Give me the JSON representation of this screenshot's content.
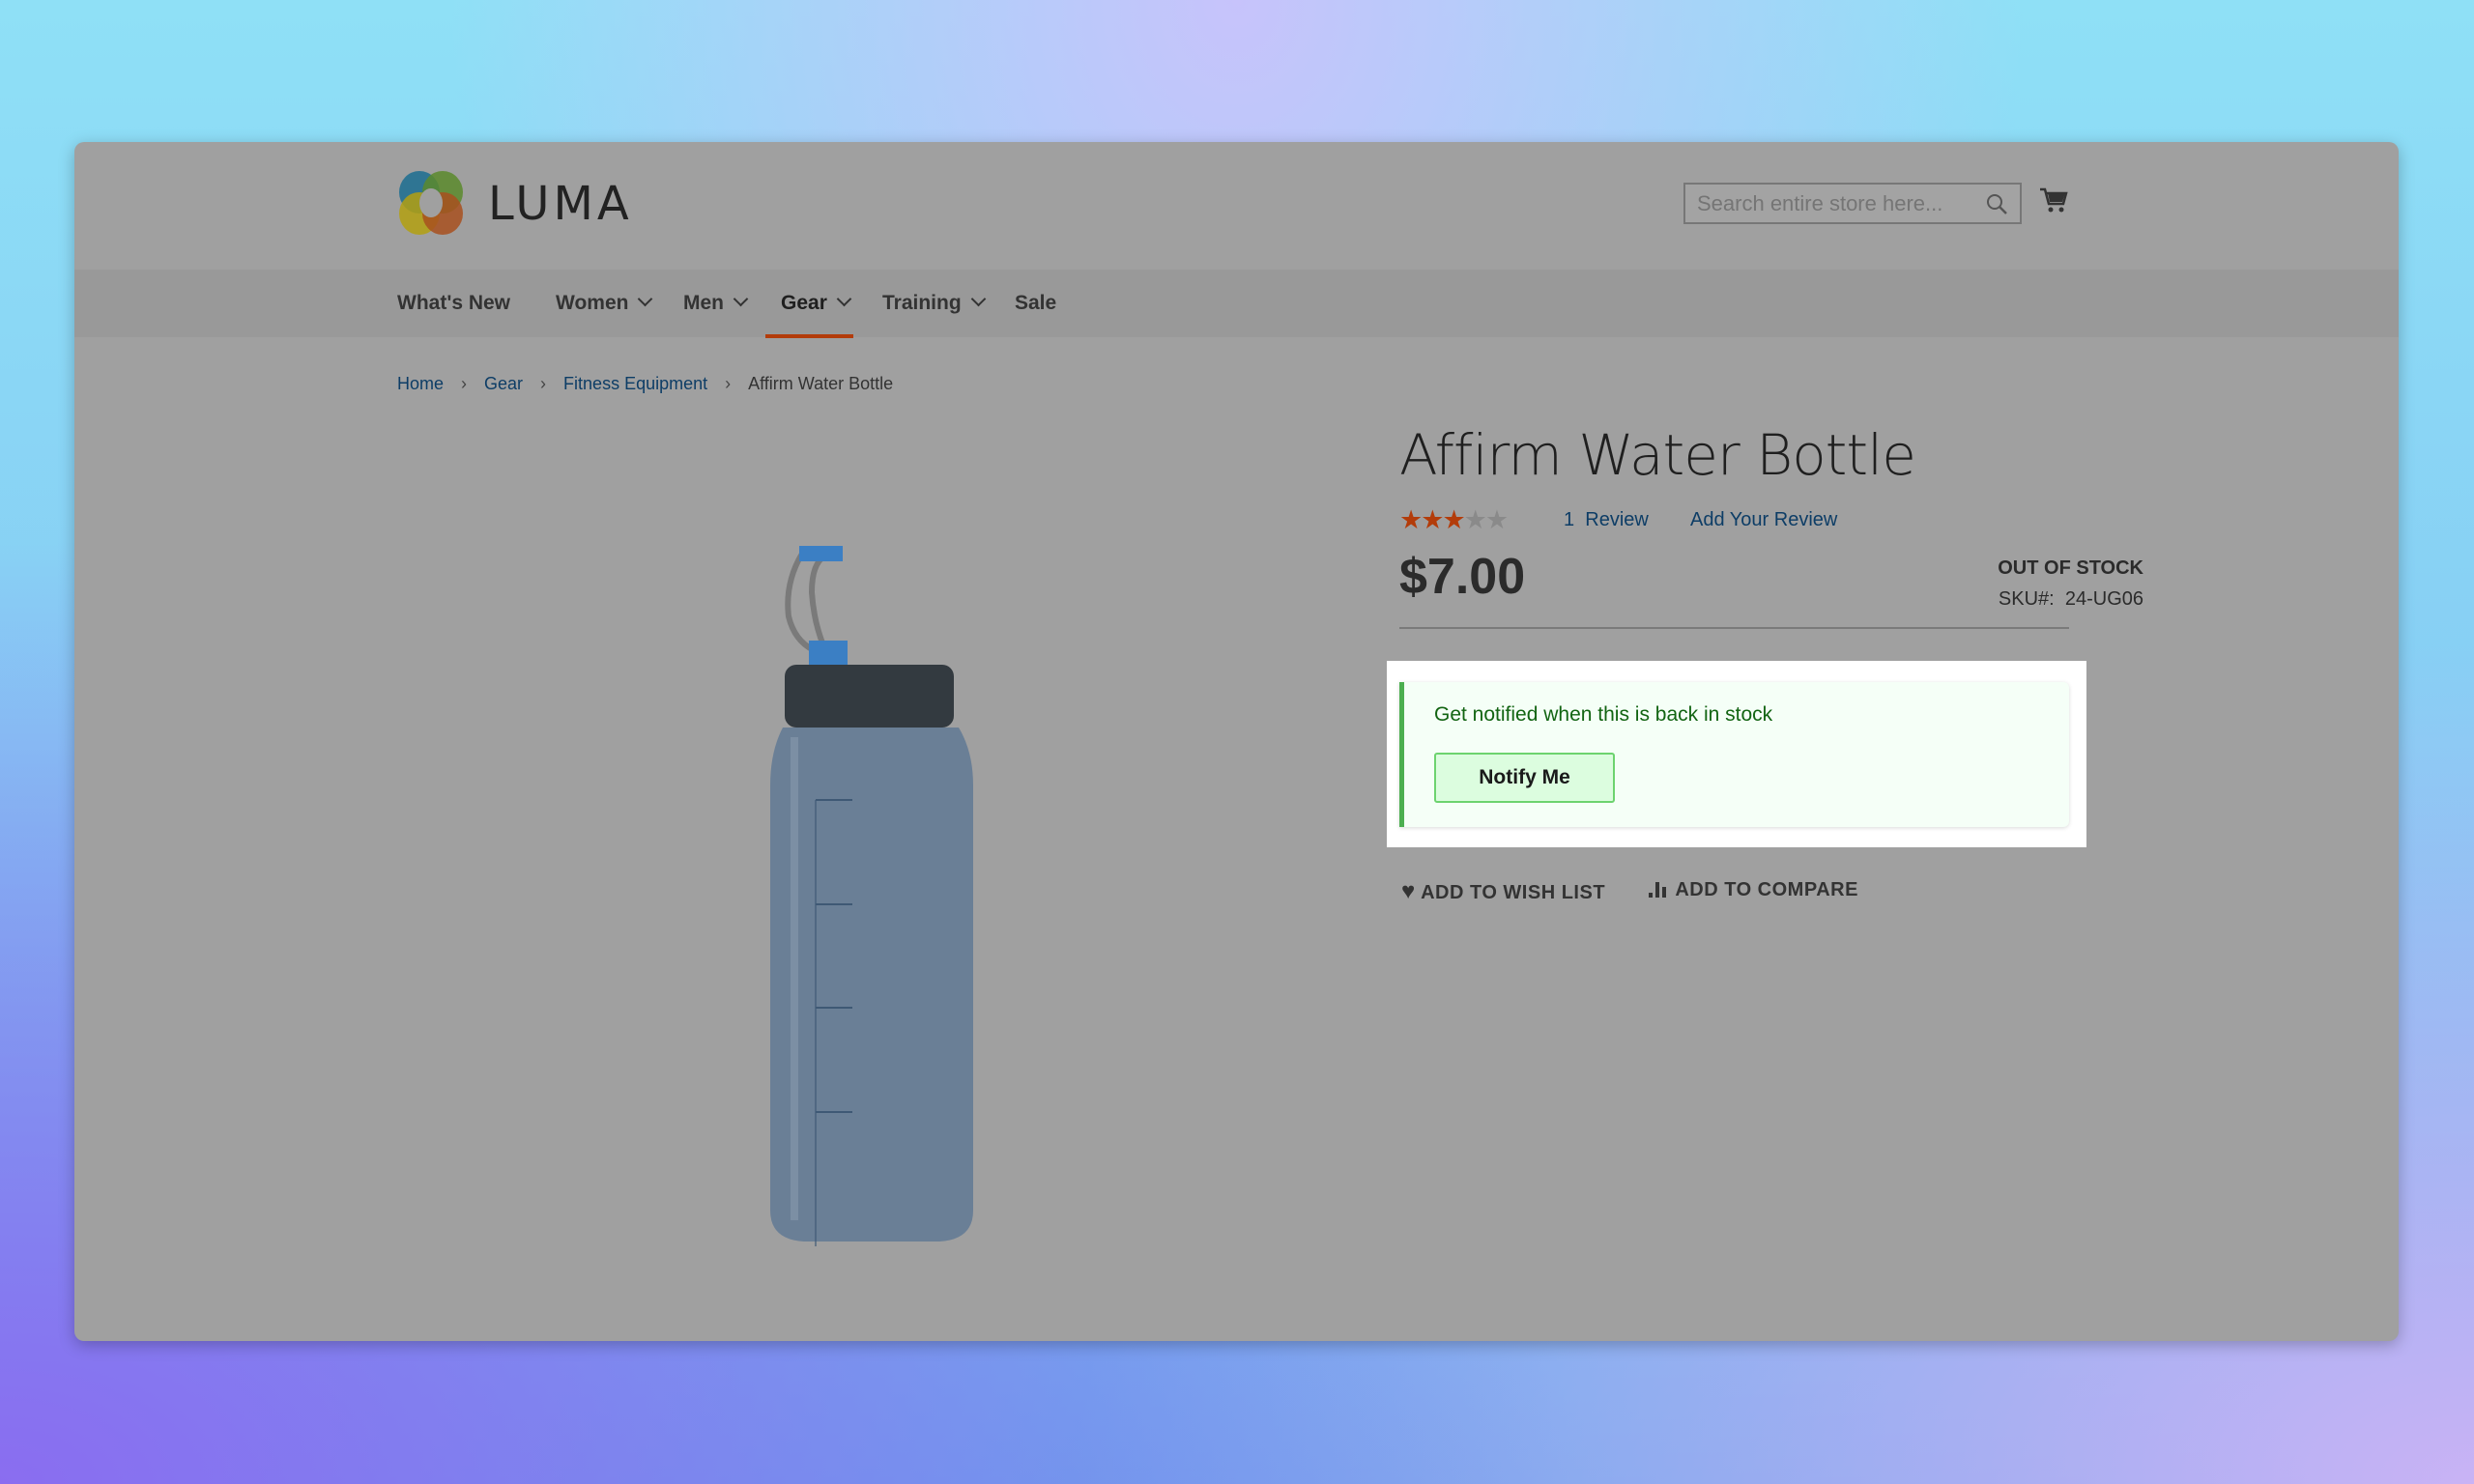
{
  "header": {
    "logo_text": "LUMA",
    "search_placeholder": "Search entire store here...",
    "cart_icon": "cart-icon",
    "search_icon": "search-icon"
  },
  "nav": {
    "items": [
      {
        "label": "What's New",
        "dropdown": false
      },
      {
        "label": "Women",
        "dropdown": true
      },
      {
        "label": "Men",
        "dropdown": true
      },
      {
        "label": "Gear",
        "dropdown": true,
        "active": true
      },
      {
        "label": "Training",
        "dropdown": true
      },
      {
        "label": "Sale",
        "dropdown": false
      }
    ]
  },
  "breadcrumb": [
    "Home",
    "Gear",
    "Fitness Equipment",
    "Affirm Water Bottle"
  ],
  "product": {
    "title": "Affirm Water Bottle",
    "rating": 3,
    "rating_max": 5,
    "review_count": "1",
    "review_label": "Review",
    "add_review": "Add Your Review",
    "price": "$7.00",
    "stock": "OUT OF STOCK",
    "sku_label": "SKU#:",
    "sku": "24-UG06"
  },
  "notify": {
    "message": "Get notified when this is back in stock",
    "button": "Notify Me"
  },
  "actions": {
    "wishlist": "ADD TO WISH LIST",
    "compare": "ADD TO COMPARE"
  },
  "colors": {
    "accent": "#b33c0a",
    "star": "#b33c0a",
    "link": "#0d3d66",
    "notify_border": "#4caf50",
    "notify_text": "#126412"
  }
}
